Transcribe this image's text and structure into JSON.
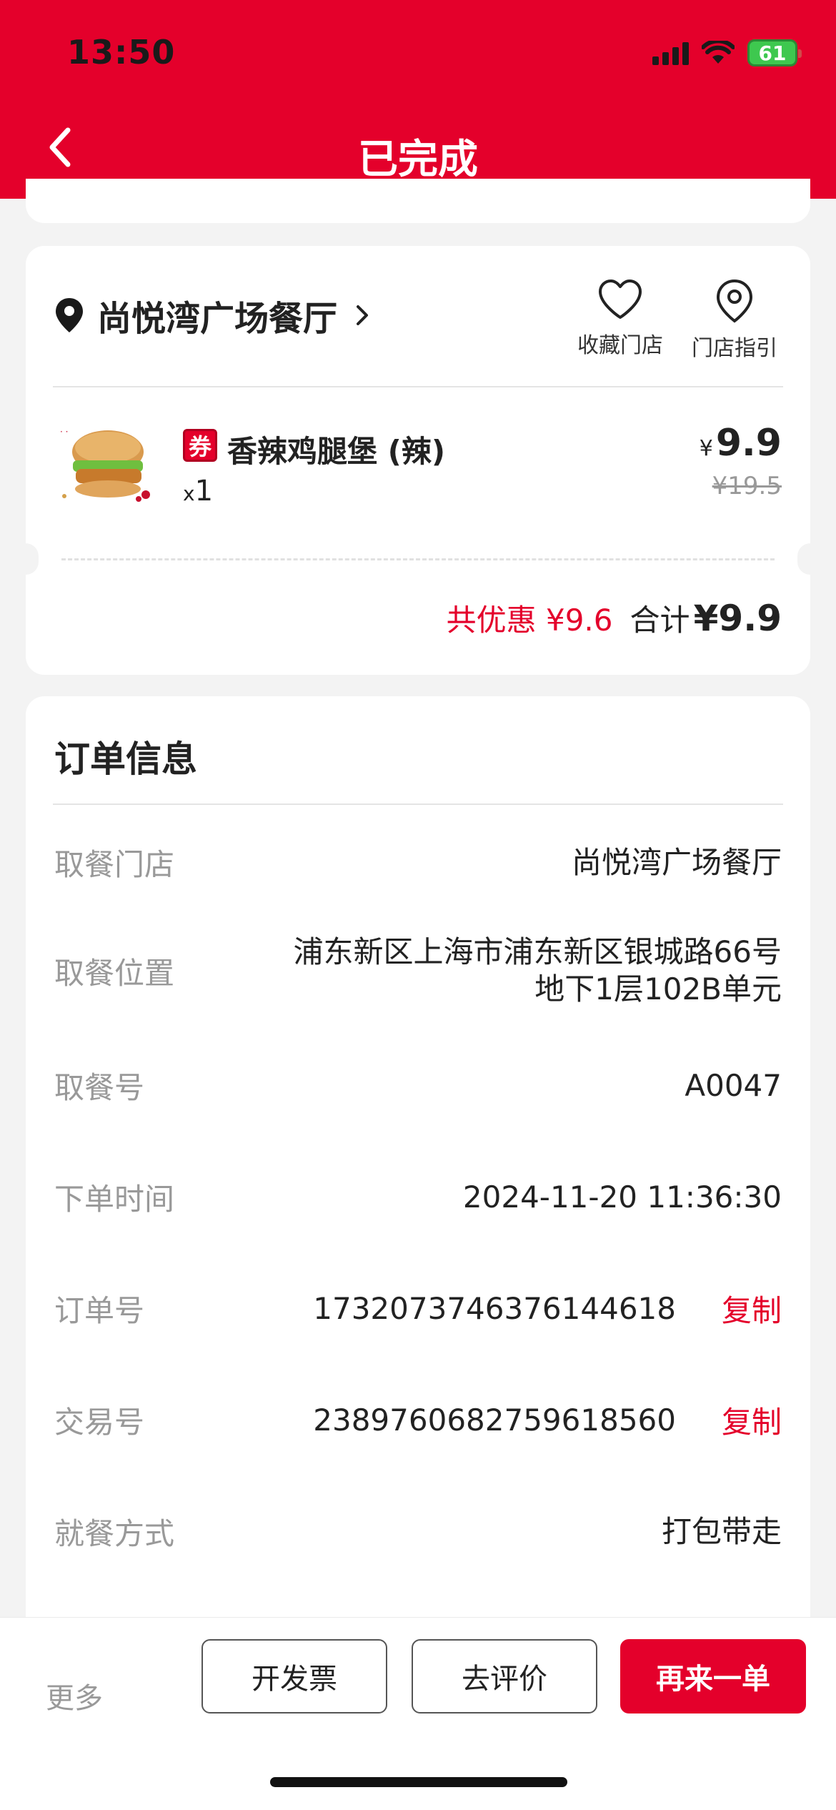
{
  "status_bar": {
    "time": "13:50",
    "battery": "61"
  },
  "header": {
    "title": "已完成",
    "back_icon": "chevron-left-icon"
  },
  "store": {
    "name": "尚悦湾广场餐厅",
    "favorite_label": "收藏门店",
    "guide_label": "门店指引"
  },
  "product": {
    "coupon_badge": "券",
    "name": "香辣鸡腿堡 (辣)",
    "qty_prefix": "x",
    "qty": "1",
    "price_symbol": "¥",
    "price": "9.9",
    "original_price": "¥19.5"
  },
  "totals": {
    "discount": "共优惠 ¥9.6",
    "total_label": "合计",
    "total_value": "¥9.9"
  },
  "order_info": {
    "title": "订单信息",
    "rows": [
      {
        "label": "取餐门店",
        "value": "尚悦湾广场餐厅"
      },
      {
        "label": "取餐位置",
        "value": "浦东新区上海市浦东新区银城路66号地下1层102B单元"
      },
      {
        "label": "取餐号",
        "value": "A0047"
      },
      {
        "label": "下单时间",
        "value": "2024-11-20 11:36:30"
      },
      {
        "label": "订单号",
        "value": "1732073746376144618",
        "action": "复制"
      },
      {
        "label": "交易号",
        "value": "2389760682759618560",
        "action": "复制"
      },
      {
        "label": "就餐方式",
        "value": "打包带走"
      }
    ]
  },
  "bottom_bar": {
    "more": "更多",
    "invoice": "开发票",
    "review": "去评价",
    "reorder": "再来一单"
  },
  "colors": {
    "brand": "#e4002b",
    "background": "#f3f3f3"
  }
}
